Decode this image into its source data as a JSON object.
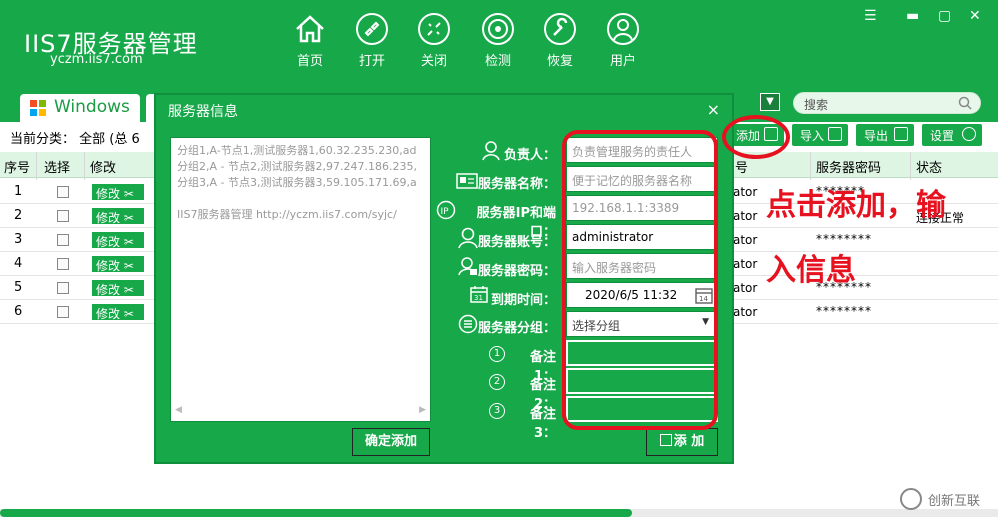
{
  "app": {
    "title": "IIS7服务器管理",
    "url": "yczm.iis7.com"
  },
  "nav": [
    {
      "label": "首页",
      "icon": "home-icon"
    },
    {
      "label": "打开",
      "icon": "link-icon"
    },
    {
      "label": "关闭",
      "icon": "unlink-icon"
    },
    {
      "label": "检测",
      "icon": "monitor-icon"
    },
    {
      "label": "恢复",
      "icon": "wrench-icon"
    },
    {
      "label": "用户",
      "icon": "user-icon"
    }
  ],
  "tabs": {
    "windows": "Windows"
  },
  "search": {
    "placeholder": "搜索"
  },
  "toolbar": {
    "category_text": "当前分类： 全部 (总 6",
    "add_label": "添加",
    "import_label": "导入",
    "export_label": "导出",
    "settings_label": "设置"
  },
  "table": {
    "headers": {
      "seq": "序号",
      "select": "选择",
      "edit": "修改",
      "acct": "号",
      "pwd": "服务器密码",
      "status": "状态"
    },
    "rows": [
      {
        "seq": "1",
        "edit": "修改",
        "acct": "ator",
        "pwd": "*******",
        "status": ""
      },
      {
        "seq": "2",
        "edit": "修改",
        "acct": "ator",
        "pwd": "",
        "status": "连接正常"
      },
      {
        "seq": "3",
        "edit": "修改",
        "acct": "ator",
        "pwd": "********",
        "status": ""
      },
      {
        "seq": "4",
        "edit": "修改",
        "acct": "ator",
        "pwd": "",
        "status": ""
      },
      {
        "seq": "5",
        "edit": "修改",
        "acct": "ator",
        "pwd": "********",
        "status": ""
      },
      {
        "seq": "6",
        "edit": "修改",
        "acct": "ator",
        "pwd": "********",
        "status": ""
      }
    ]
  },
  "dialog": {
    "title": "服务器信息",
    "close": "×",
    "textarea_lines": [
      "分组1,A-节点1,测试服务器1,60.32.235.230,ad",
      "分组2,A - 节点2,测试服务器2,97.247.186.235,",
      "分组3,A - 节点3,测试服务器3,59.105.171.69,a",
      "",
      "IIS7服务器管理 http://yczm.iis7.com/syjc/"
    ],
    "confirm_add": "确定添加",
    "add_button": "添 加",
    "fields": [
      {
        "label": "负责人：",
        "value": "负责管理服务的责任人",
        "placeholder": true
      },
      {
        "label": "服务器名称：",
        "value": "便于记忆的服务器名称",
        "placeholder": true
      },
      {
        "label": "服务器IP和端口：",
        "value": "192.168.1.1:3389",
        "placeholder": true
      },
      {
        "label": "服务器账号：",
        "value": "administrator",
        "placeholder": false
      },
      {
        "label": "服务器密码：",
        "value": "输入服务器密码",
        "placeholder": true
      },
      {
        "label": "到期时间：",
        "value": "2020/6/5 11:32",
        "placeholder": false
      },
      {
        "label": "服务器分组：",
        "value": "选择分组",
        "placeholder": false
      },
      {
        "label": "备注1：",
        "value": "",
        "placeholder": false
      },
      {
        "label": "备注2：",
        "value": "",
        "placeholder": false
      },
      {
        "label": "备注3：",
        "value": "",
        "placeholder": false
      }
    ],
    "remark_numbers": [
      "1",
      "2",
      "3"
    ]
  },
  "annotation": {
    "line1": "点击添加，输",
    "line2": "入信息"
  },
  "watermark": "创新互联",
  "colors": {
    "brand_green": "#17a84a",
    "annotation_red": "#e6121f"
  }
}
